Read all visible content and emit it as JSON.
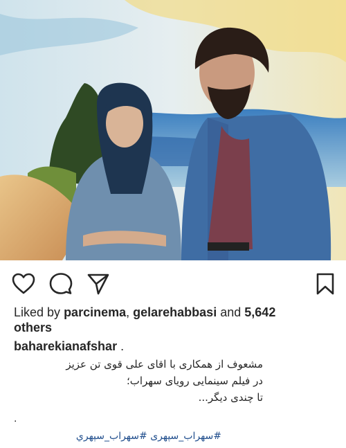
{
  "post": {
    "likes": {
      "prefix": "Liked by",
      "user1": "parcinema",
      "separator": ",",
      "user2": "gelarehabbasi",
      "and": "and",
      "count": "5,642",
      "others": "others"
    },
    "author": {
      "username": "baharekianafshar",
      "suffix": "."
    },
    "caption": {
      "line1": "مشعوف از همکاری با اقای علی قوی تن عزیز",
      "line2": "در فیلم سینمایی رویای سهراب؛",
      "line3": "تا چندی دیگر...",
      "line4": "."
    },
    "hashtags": {
      "tag1": "#سهراب_سپهری",
      "tag2": "#سهراب_سپهري"
    }
  },
  "icons": {
    "like": "heart-icon",
    "comment": "comment-bubble-icon",
    "share": "paper-plane-icon",
    "save": "bookmark-icon"
  },
  "colors": {
    "text": "#262626",
    "hashtag": "#1f4d8c",
    "background": "#ffffff"
  }
}
